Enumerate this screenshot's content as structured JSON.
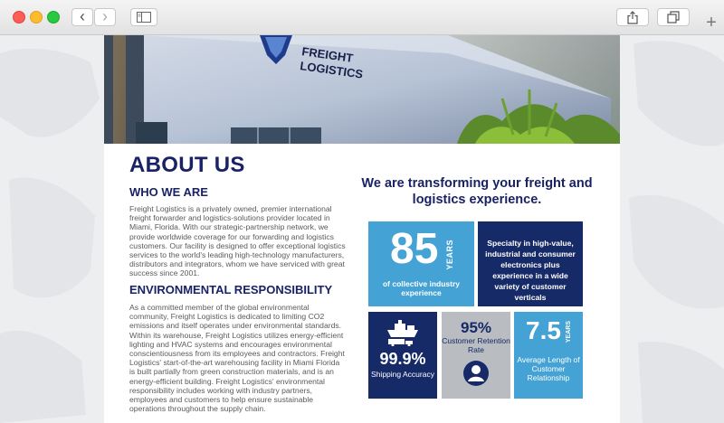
{
  "browser": {
    "back_glyph": "‹",
    "forward_glyph": "›",
    "new_tab_glyph": "+"
  },
  "about": {
    "title": "ABOUT US",
    "who_heading": "WHO WE ARE",
    "who_text": "Freight Logistics is a privately owned, premier international freight forwarder and logistics-solutions provider located in Miami, Florida. With our strategic-partnership network, we provide worldwide coverage for our forwarding and logistics customers. Our facility is designed to offer exceptional logistics services to the world's leading high-technology manufacturers, distributors and integrators, whom we have serviced with great success since 2001.",
    "env_heading": "ENVIRONMENTAL RESPONSIBILITY",
    "env_text": "As a committed member of the global environmental community, Freight Logistics is dedicated to limiting CO2 emissions and itself operates under environmental standards. Within its warehouse, Freight Logistics utilizes energy-efficient lighting and HVAC systems and encourages environmental conscientiousness from its employees and contractors. Freight Logistics' start-of-the-art warehousing facility in Miami Florida is built partially from green construction materials, and is an energy-efficient building. Freight Logistics' environmental responsibility includes working with industry partners, employees and customers to help ensure sustainable operations throughout the supply chain."
  },
  "hero": {
    "sign_line1": "FREIGHT",
    "sign_line2": "LOGISTICS"
  },
  "stats": {
    "headline": "We are transforming your freight and logistics experience.",
    "years_number": "85",
    "years_label": "YEARS",
    "years_caption": "of collective industry experience",
    "specialty_text": "Specialty in high-value, industrial and consumer electronics plus experience in a wide variety of customer verticals",
    "shipping_value": "99.9%",
    "shipping_caption": "Shipping Accuracy",
    "retention_value": "95%",
    "retention_caption": "Customer Retention Rate",
    "length_value": "7.5",
    "length_unit": "YEARS",
    "length_caption": "Average Length of Customer Relationship"
  },
  "colors": {
    "navy": "#162a68",
    "heading": "#1a2266",
    "light_blue": "#44a2d4",
    "gray": "#b9bcc0"
  },
  "icons": [
    "back-icon",
    "forward-icon",
    "sidebar-icon",
    "share-icon",
    "tabs-icon",
    "add-tab-icon",
    "ship-truck-icon",
    "customer-icon"
  ]
}
